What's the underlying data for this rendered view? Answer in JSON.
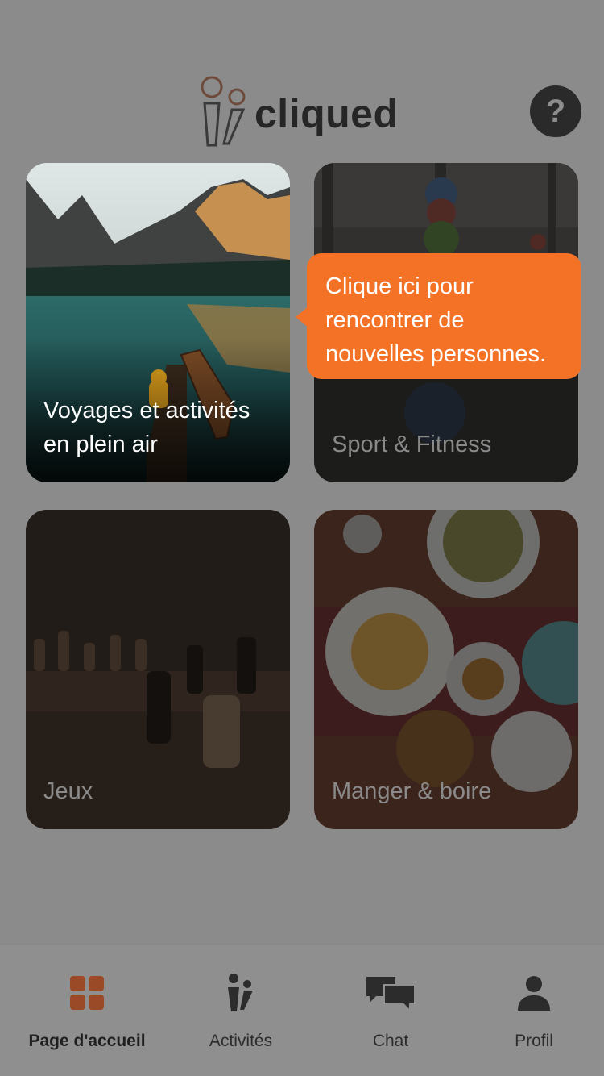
{
  "header": {
    "app_name": "cliqued",
    "help_label": "?"
  },
  "categories": [
    {
      "label": "Voyages et activités en plein air"
    },
    {
      "label": "Sport & Fitness"
    },
    {
      "label": "Jeux"
    },
    {
      "label": "Manger & boire"
    }
  ],
  "tooltip": {
    "text_line1": "Clique ici pour",
    "text_line2": "rencontrer de",
    "text_line3": "nouvelles personnes."
  },
  "nav": {
    "items": [
      {
        "label": "Page d'accueil",
        "icon": "grid-icon"
      },
      {
        "label": "Activités",
        "icon": "people-icon"
      },
      {
        "label": "Chat",
        "icon": "chat-bubbles-icon"
      },
      {
        "label": "Profil",
        "icon": "user-icon"
      }
    ]
  },
  "colors": {
    "accent": "#f47226",
    "overlay_background": "#8b8b8b",
    "active_nav_icon": "#9a4a26"
  }
}
